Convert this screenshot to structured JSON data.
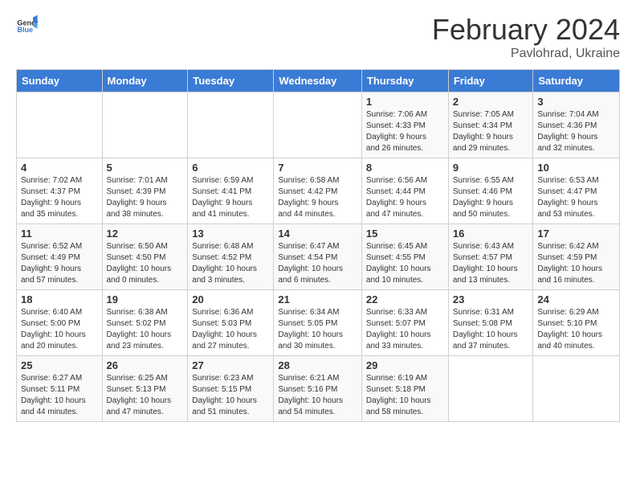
{
  "header": {
    "logo_general": "General",
    "logo_blue": "Blue",
    "title": "February 2024",
    "subtitle": "Pavlohrad, Ukraine"
  },
  "columns": [
    "Sunday",
    "Monday",
    "Tuesday",
    "Wednesday",
    "Thursday",
    "Friday",
    "Saturday"
  ],
  "weeks": [
    [
      {
        "day": "",
        "info": ""
      },
      {
        "day": "",
        "info": ""
      },
      {
        "day": "",
        "info": ""
      },
      {
        "day": "",
        "info": ""
      },
      {
        "day": "1",
        "info": "Sunrise: 7:06 AM\nSunset: 4:33 PM\nDaylight: 9 hours\nand 26 minutes."
      },
      {
        "day": "2",
        "info": "Sunrise: 7:05 AM\nSunset: 4:34 PM\nDaylight: 9 hours\nand 29 minutes."
      },
      {
        "day": "3",
        "info": "Sunrise: 7:04 AM\nSunset: 4:36 PM\nDaylight: 9 hours\nand 32 minutes."
      }
    ],
    [
      {
        "day": "4",
        "info": "Sunrise: 7:02 AM\nSunset: 4:37 PM\nDaylight: 9 hours\nand 35 minutes."
      },
      {
        "day": "5",
        "info": "Sunrise: 7:01 AM\nSunset: 4:39 PM\nDaylight: 9 hours\nand 38 minutes."
      },
      {
        "day": "6",
        "info": "Sunrise: 6:59 AM\nSunset: 4:41 PM\nDaylight: 9 hours\nand 41 minutes."
      },
      {
        "day": "7",
        "info": "Sunrise: 6:58 AM\nSunset: 4:42 PM\nDaylight: 9 hours\nand 44 minutes."
      },
      {
        "day": "8",
        "info": "Sunrise: 6:56 AM\nSunset: 4:44 PM\nDaylight: 9 hours\nand 47 minutes."
      },
      {
        "day": "9",
        "info": "Sunrise: 6:55 AM\nSunset: 4:46 PM\nDaylight: 9 hours\nand 50 minutes."
      },
      {
        "day": "10",
        "info": "Sunrise: 6:53 AM\nSunset: 4:47 PM\nDaylight: 9 hours\nand 53 minutes."
      }
    ],
    [
      {
        "day": "11",
        "info": "Sunrise: 6:52 AM\nSunset: 4:49 PM\nDaylight: 9 hours\nand 57 minutes."
      },
      {
        "day": "12",
        "info": "Sunrise: 6:50 AM\nSunset: 4:50 PM\nDaylight: 10 hours\nand 0 minutes."
      },
      {
        "day": "13",
        "info": "Sunrise: 6:48 AM\nSunset: 4:52 PM\nDaylight: 10 hours\nand 3 minutes."
      },
      {
        "day": "14",
        "info": "Sunrise: 6:47 AM\nSunset: 4:54 PM\nDaylight: 10 hours\nand 6 minutes."
      },
      {
        "day": "15",
        "info": "Sunrise: 6:45 AM\nSunset: 4:55 PM\nDaylight: 10 hours\nand 10 minutes."
      },
      {
        "day": "16",
        "info": "Sunrise: 6:43 AM\nSunset: 4:57 PM\nDaylight: 10 hours\nand 13 minutes."
      },
      {
        "day": "17",
        "info": "Sunrise: 6:42 AM\nSunset: 4:59 PM\nDaylight: 10 hours\nand 16 minutes."
      }
    ],
    [
      {
        "day": "18",
        "info": "Sunrise: 6:40 AM\nSunset: 5:00 PM\nDaylight: 10 hours\nand 20 minutes."
      },
      {
        "day": "19",
        "info": "Sunrise: 6:38 AM\nSunset: 5:02 PM\nDaylight: 10 hours\nand 23 minutes."
      },
      {
        "day": "20",
        "info": "Sunrise: 6:36 AM\nSunset: 5:03 PM\nDaylight: 10 hours\nand 27 minutes."
      },
      {
        "day": "21",
        "info": "Sunrise: 6:34 AM\nSunset: 5:05 PM\nDaylight: 10 hours\nand 30 minutes."
      },
      {
        "day": "22",
        "info": "Sunrise: 6:33 AM\nSunset: 5:07 PM\nDaylight: 10 hours\nand 33 minutes."
      },
      {
        "day": "23",
        "info": "Sunrise: 6:31 AM\nSunset: 5:08 PM\nDaylight: 10 hours\nand 37 minutes."
      },
      {
        "day": "24",
        "info": "Sunrise: 6:29 AM\nSunset: 5:10 PM\nDaylight: 10 hours\nand 40 minutes."
      }
    ],
    [
      {
        "day": "25",
        "info": "Sunrise: 6:27 AM\nSunset: 5:11 PM\nDaylight: 10 hours\nand 44 minutes."
      },
      {
        "day": "26",
        "info": "Sunrise: 6:25 AM\nSunset: 5:13 PM\nDaylight: 10 hours\nand 47 minutes."
      },
      {
        "day": "27",
        "info": "Sunrise: 6:23 AM\nSunset: 5:15 PM\nDaylight: 10 hours\nand 51 minutes."
      },
      {
        "day": "28",
        "info": "Sunrise: 6:21 AM\nSunset: 5:16 PM\nDaylight: 10 hours\nand 54 minutes."
      },
      {
        "day": "29",
        "info": "Sunrise: 6:19 AM\nSunset: 5:18 PM\nDaylight: 10 hours\nand 58 minutes."
      },
      {
        "day": "",
        "info": ""
      },
      {
        "day": "",
        "info": ""
      }
    ]
  ]
}
